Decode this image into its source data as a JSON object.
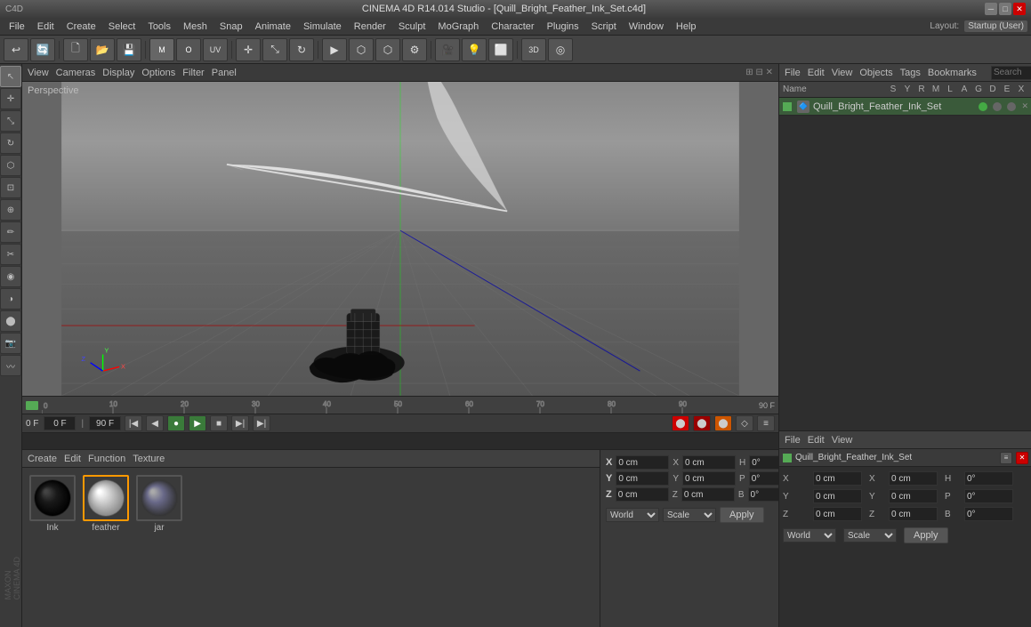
{
  "title_bar": {
    "text": "CINEMA 4D R14.014 Studio - [Quill_Bright_Feather_Ink_Set.c4d]",
    "min": "─",
    "max": "□",
    "close": "✕"
  },
  "menu_bar": {
    "items": [
      "File",
      "Edit",
      "Create",
      "Select",
      "Tools",
      "Mesh",
      "Snap",
      "Animate",
      "Simulate",
      "Render",
      "Sculpt",
      "MoGraph",
      "Character",
      "Plugins",
      "Script",
      "Window",
      "Help"
    ]
  },
  "layout": {
    "label": "Layout:",
    "preset": "Startup (User)"
  },
  "viewport": {
    "label": "Perspective",
    "menus": [
      "View",
      "Cameras",
      "Display",
      "Options",
      "Filter",
      "Panel"
    ]
  },
  "right_panel": {
    "obj_bar_menus": [
      "File",
      "Edit",
      "View",
      "Objects",
      "Tags",
      "Bookmarks"
    ],
    "obj_name_col": "Name",
    "obj_entry": "Quill_Bright_Feather_Ink_Set",
    "search_placeholder": "Search",
    "attr_bar_menus": [
      "File",
      "Edit",
      "View"
    ],
    "obj_entry2": "Quill_Bright_Feather_Ink_Set"
  },
  "materials": {
    "menus": [
      "Create",
      "Edit",
      "Function",
      "Texture"
    ],
    "items": [
      {
        "label": "Ink",
        "preview_type": "sphere-dark"
      },
      {
        "label": "feather",
        "preview_type": "sphere-light",
        "selected": true
      },
      {
        "label": "jar",
        "preview_type": "sphere-reflective"
      }
    ]
  },
  "coordinates": {
    "x_label": "X",
    "y_label": "Y",
    "z_label": "Z",
    "x_pos": "0 cm",
    "y_pos": "0 cm",
    "z_pos": "0 cm",
    "x_size": "0 cm",
    "y_size": "0 cm",
    "z_size": "0 cm",
    "h_val": "0°",
    "p_val": "0°",
    "b_val": "0°",
    "world": "World",
    "scale": "Scale",
    "apply": "Apply"
  },
  "timeline": {
    "current_frame": "0 F",
    "min_frame": "0 F",
    "max_frame": "90 F",
    "fps": "90 F",
    "ticks": [
      "0",
      "10",
      "20",
      "30",
      "40",
      "50",
      "60",
      "70",
      "80",
      "90"
    ]
  },
  "toolbar_icons": {
    "icons": [
      "◎",
      "⟳",
      "⊞",
      "⊕",
      "🔽",
      "📐",
      "📦",
      "⚙",
      "🔵",
      "⬡",
      "▶",
      "⬤",
      "◑",
      "◯",
      "🎯",
      "🔺",
      "📷",
      "🎬",
      "⬡",
      "◈",
      "⊕",
      "☀",
      "💡",
      "🔲"
    ]
  },
  "left_tools": {
    "icons": [
      "↖",
      "⊞",
      "🔵",
      "◎",
      "◯",
      "⬡",
      "⊡",
      "✏",
      "⬤",
      "↔",
      "✂",
      "🔲",
      "⊠",
      "⊕"
    ]
  },
  "obj_columns": {
    "headers": [
      "Name",
      "S",
      "Y",
      "R",
      "M",
      "L",
      "A",
      "G",
      "D",
      "E",
      "X"
    ]
  },
  "brand": "MAXON\nCINEMA 4D"
}
